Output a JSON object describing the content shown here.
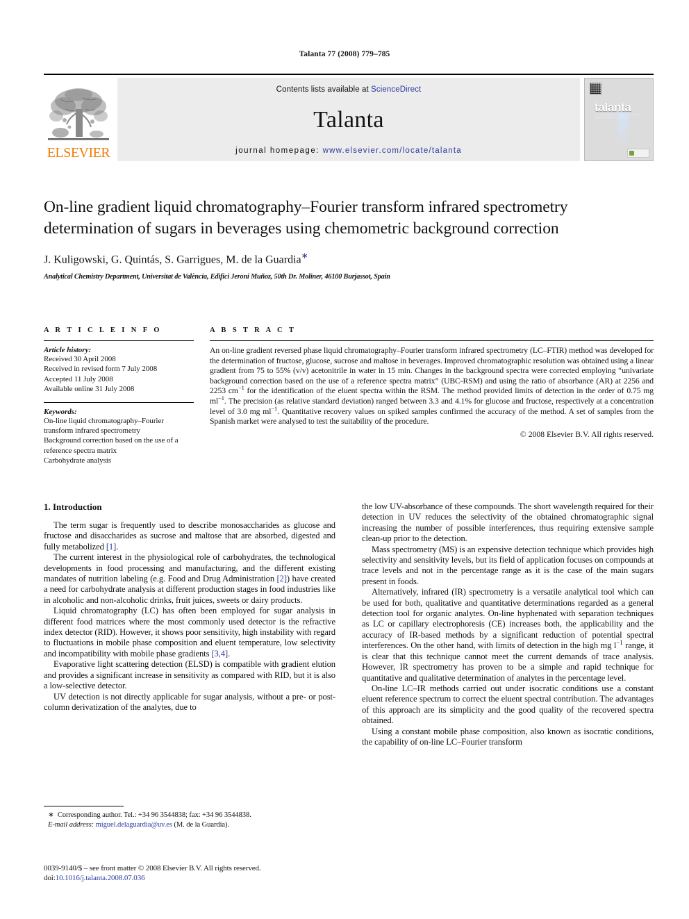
{
  "running_head": "Talanta 77 (2008) 779–785",
  "masthead": {
    "publisher_logo_text": "ELSEVIER",
    "contents_prefix": "Contents lists available at ",
    "contents_link": "ScienceDirect",
    "journal_name": "Talanta",
    "homepage_prefix": "journal homepage: ",
    "homepage_url": "www.elsevier.com/locate/talanta",
    "cover_title": "talanta",
    "cover_subtitle": "The International Journal of Pure and Applied Analytical Chemistry"
  },
  "article": {
    "title": "On-line gradient liquid chromatography–Fourier transform infrared spectrometry determination of sugars in beverages using chemometric background correction",
    "authors": "J. Kuligowski, G. Quintás, S. Garrigues, M. de la Guardia",
    "corresponding_marker": "∗",
    "affiliation": "Analytical Chemistry Department, Universitat de València, Edifici Jeroni Muñoz, 50th Dr. Moliner, 46100 Burjassot, Spain"
  },
  "article_info": {
    "heading": "A R T I C L E   I N F O",
    "history_label": "Article history:",
    "history": [
      "Received 30 April 2008",
      "Received in revised form 7 July 2008",
      "Accepted 11 July 2008",
      "Available online 31 July 2008"
    ],
    "keywords_label": "Keywords:",
    "keywords": [
      "On-line liquid chromatography–Fourier transform infrared spectrometry",
      "Background correction based on the use of a reference spectra matrix",
      "Carbohydrate analysis"
    ]
  },
  "abstract": {
    "heading": "A B S T R A C T",
    "text_part1": "An on-line gradient reversed phase liquid chromatography–Fourier transform infrared spectrometry (LC–FTIR) method was developed for the determination of fructose, glucose, sucrose and maltose in beverages. Improved chromatographic resolution was obtained using a linear gradient from 75 to 55% (v/v) acetonitrile in water in 15 min. Changes in the background spectra were corrected employing “univariate background correction based on the use of a reference spectra matrix” (UBC-RSM) and using the ratio of absorbance (AR) at 2256 and 2253 cm",
    "sup1": "−1",
    "text_part2": " for the identification of the eluent spectra within the RSM. The method provided limits of detection in the order of 0.75 mg ml",
    "sup2": "−1",
    "text_part3": ". The precision (as relative standard deviation) ranged between 3.3 and 4.1% for glucose and fructose, respectively at a concentration level of 3.0 mg ml",
    "sup3": "−1",
    "text_part4": ". Quantitative recovery values on spiked samples confirmed the accuracy of the method. A set of samples from the Spanish market were analysed to test the suitability of the procedure.",
    "copyright": "© 2008 Elsevier B.V. All rights reserved."
  },
  "introduction": {
    "section_number_title": "1. Introduction",
    "left_paragraphs": [
      {
        "a": "The term sugar is frequently used to describe monosaccharides as glucose and fructose and disaccharides as sucrose and maltose that are absorbed, digested and fully metabolized ",
        "ref1": "[1]",
        "b": "."
      },
      {
        "a": "The current interest in the physiological role of carbohydrates, the technological developments in food processing and manufacturing, and the different existing mandates of nutrition labeling (e.g. Food and Drug Administration ",
        "ref1": "[2]",
        "b": ") have created a need for carbohydrate analysis at different production stages in food industries like in alcoholic and non-alcoholic drinks, fruit juices, sweets or dairy products."
      },
      {
        "a": "Liquid chromatography (LC) has often been employed for sugar analysis in different food matrices where the most commonly used detector is the refractive index detector (RID). However, it shows poor sensitivity, high instability with regard to fluctuations in mobile phase composition and eluent temperature, low selectivity and incompatibility with mobile phase gradients ",
        "ref1": "[3,4]",
        "b": "."
      },
      {
        "a": "Evaporative light scattering detection (ELSD) is compatible with gradient elution and provides a significant increase in sensitivity as compared with RID, but it is also a low-selective detector.",
        "ref1": "",
        "b": ""
      },
      {
        "a": "UV detection is not directly applicable for sugar analysis, without a pre- or post-column derivatization of the analytes, due to",
        "ref1": "",
        "b": ""
      }
    ],
    "right_first_continuation": "the low UV-absorbance of these compounds. The short wavelength required for their detection in UV reduces the selectivity of the obtained chromatographic signal increasing the number of possible interferences, thus requiring extensive sample clean-up prior to the detection.",
    "right_paragraphs": [
      "Mass spectrometry (MS) is an expensive detection technique which provides high selectivity and sensitivity levels, but its field of application focuses on compounds at trace levels and not in the percentage range as it is the case of the main sugars present in foods.",
      "Alternatively, infrared (IR) spectrometry is a versatile analytical tool which can be used for both, qualitative and quantitative determinations regarded as a general detection tool for organic analytes. On-line hyphenated with separation techniques as LC or capillary electrophoresis (CE) increases both, the applicability and the accuracy of IR-based methods by a significant reduction of potential spectral interferences. On the other hand, with limits of detection in the high mg l",
      "On-line LC–IR methods carried out under isocratic conditions use a constant eluent reference spectrum to correct the eluent spectral contribution. The advantages of this approach are its simplicity and the good quality of the recovered spectra obtained.",
      "Using a constant mobile phase composition, also known as isocratic conditions, the capability of on-line LC–Fourier transform"
    ],
    "right_para2_sup": "−1",
    "right_para2_tail": " range, it is clear that this technique cannot meet the current demands of trace analysis. However, IR spectrometry has proven to be a simple and rapid technique for quantitative and qualitative determination of analytes in the percentage level."
  },
  "footnotes": {
    "corresponding_marker": "∗",
    "corresponding_text": "Corresponding author. Tel.: +34 96 3544838; fax: +34 96 3544838.",
    "email_label": "E-mail address:",
    "email": "miguel.delaguardia@uv.es",
    "email_owner": "(M. de la Guardia).",
    "issn_line": "0039-9140/$ – see front matter © 2008 Elsevier B.V. All rights reserved.",
    "doi_label": "doi:",
    "doi_value": "10.1016/j.talanta.2008.07.036"
  },
  "colors": {
    "link": "#2b3b9e",
    "elsevier_orange": "#F07F09",
    "panel_gray": "#ececec"
  }
}
